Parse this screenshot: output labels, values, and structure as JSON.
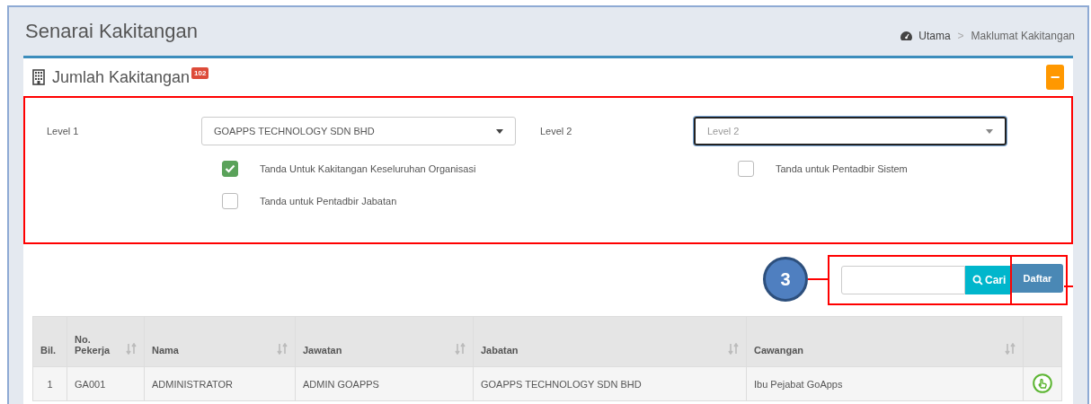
{
  "page_title": "Senarai Kakitangan",
  "breadcrumb": {
    "home": "Utama",
    "separator": ">",
    "current": "Maklumat Kakitangan"
  },
  "panel": {
    "title": "Jumlah Kakitangan",
    "count_badge": "102",
    "collapse_button": "−"
  },
  "filters": {
    "level_1": {
      "label": "Level 1",
      "value": "GOAPPS TECHNOLOGY SDN BHD"
    },
    "level_2": {
      "label": "Level 2",
      "placeholder": "Level 2",
      "focused": true
    }
  },
  "checkboxes": [
    {
      "label": "Tanda Untuk Kakitangan Keseluruhan Organisasi",
      "checked": true
    },
    {
      "label": "Tanda untuk Pentadbir Sistem",
      "checked": false
    },
    {
      "label": "Tanda untuk Pentadbir Jabatan",
      "checked": false
    }
  ],
  "search": {
    "button": "Cari",
    "register_button": "Daftar"
  },
  "callout": "3",
  "table": {
    "columns": [
      {
        "label": "Bil.",
        "sortable": false
      },
      {
        "label": "No. Pekerja",
        "sortable": true
      },
      {
        "label": "Nama",
        "sortable": true
      },
      {
        "label": "Jawatan",
        "sortable": true
      },
      {
        "label": "Jabatan",
        "sortable": true
      },
      {
        "label": "Cawangan",
        "sortable": true
      }
    ],
    "rows": [
      {
        "cells": [
          "1",
          "GA001",
          "ADMINISTRATOR",
          "ADMIN GOAPPS",
          "GOAPPS TECHNOLOGY SDN BHD",
          "Ibu Pejabat GoApps"
        ]
      }
    ]
  }
}
